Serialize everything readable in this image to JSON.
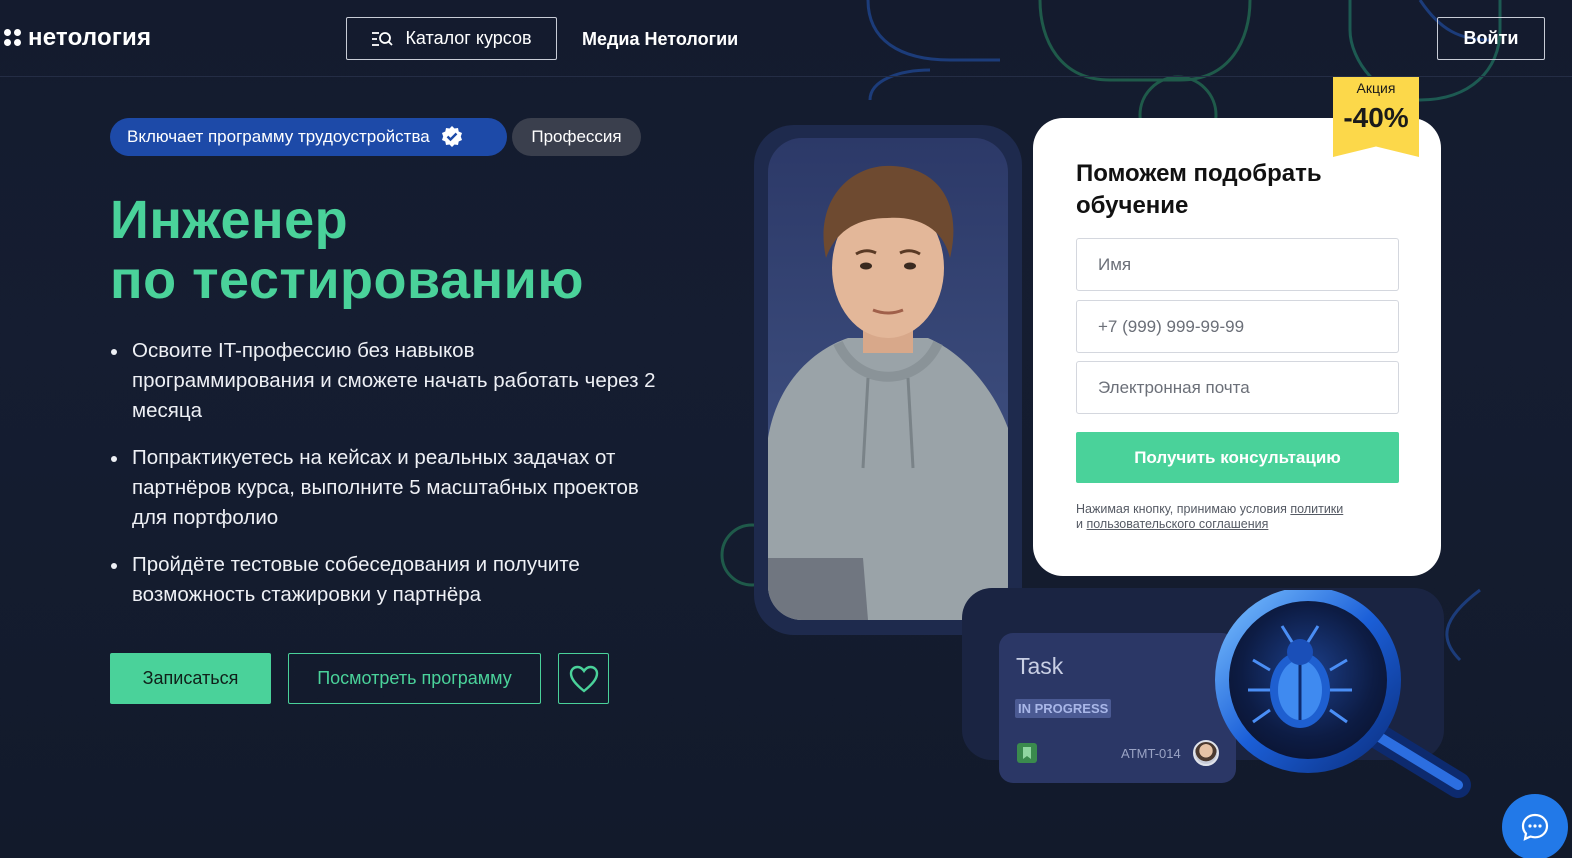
{
  "header": {
    "logo_text": "нетология",
    "catalog_label": "Каталог курсов",
    "media_label": "Медиа Нетологии",
    "login_label": "Войти"
  },
  "hero": {
    "tag_employment": "Включает программу трудоустройства",
    "tag_profession": "Профессия",
    "title_line1": "Инженер",
    "title_line2": "по тестированию",
    "bullets": [
      "Освоите IT-профессию без навыков программирования и сможете начать работать через 2 месяца",
      "Попрактикуетесь на кейсах и реальных задачах от партнёров курса, выполните 5 масштабных проектов для портфолио",
      "Пройдёте тестовые собеседования и получите возможность стажировки у партнёра"
    ],
    "signup_label": "Записаться",
    "program_label": "Посмотреть программу"
  },
  "form": {
    "title": "Поможем подобрать обучение",
    "name_placeholder": "Имя",
    "phone_placeholder": "+7 (999) 999-99-99",
    "email_placeholder": "Электронная почта",
    "submit_label": "Получить консультацию",
    "disclaimer_prefix": "Нажимая кнопку, принимаю условия",
    "policy_link": "политики",
    "disclaimer_and": "и",
    "agreement_link": "пользовательского соглашения"
  },
  "promo": {
    "label": "Акция",
    "discount": "-40%"
  },
  "task_card": {
    "title": "Task",
    "status": "IN PROGRESS",
    "id": "ATMT-014"
  },
  "colors": {
    "accent": "#4ad29a",
    "background": "#141b2e",
    "tag_blue": "#1d4aa8",
    "promo_yellow": "#fcd84a",
    "chat_blue": "#2279e8"
  },
  "icons": [
    "logo-icon",
    "catalog-search-icon",
    "verified-check-icon",
    "heart-icon",
    "bookmark-icon",
    "bug-magnifier-icon",
    "chat-icon"
  ]
}
